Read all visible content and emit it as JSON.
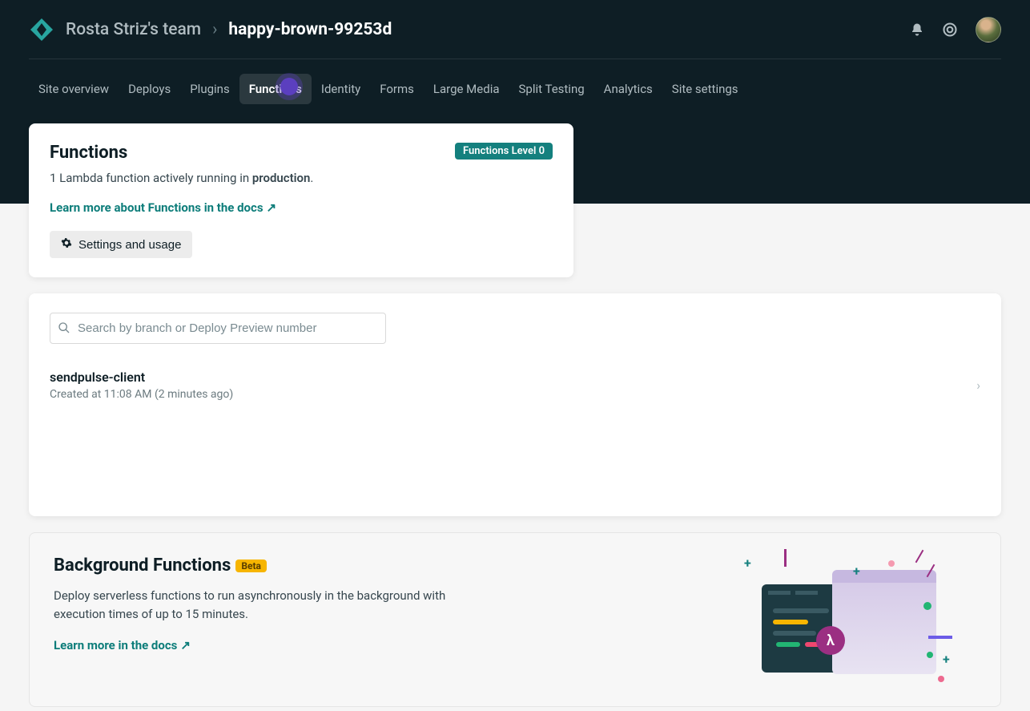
{
  "breadcrumb": {
    "team": "Rosta Striz's team",
    "site": "happy-brown-99253d"
  },
  "tabs": [
    {
      "label": "Site overview",
      "active": false
    },
    {
      "label": "Deploys",
      "active": false
    },
    {
      "label": "Plugins",
      "active": false
    },
    {
      "label": "Functions",
      "active": true
    },
    {
      "label": "Identity",
      "active": false
    },
    {
      "label": "Forms",
      "active": false
    },
    {
      "label": "Large Media",
      "active": false
    },
    {
      "label": "Split Testing",
      "active": false
    },
    {
      "label": "Analytics",
      "active": false
    },
    {
      "label": "Site settings",
      "active": false
    }
  ],
  "functions_card": {
    "title": "Functions",
    "level_badge": "Functions Level 0",
    "summary_prefix": "1 Lambda function actively running in ",
    "summary_strong": "production",
    "summary_suffix": ".",
    "docs_link": "Learn more about Functions in the docs",
    "settings_btn": "Settings and usage"
  },
  "search": {
    "placeholder": "Search by branch or Deploy Preview number"
  },
  "functions_list": [
    {
      "name": "sendpulse-client",
      "meta": "Created at 11:08 AM (2 minutes ago)"
    }
  ],
  "promo": {
    "title": "Background Functions",
    "badge": "Beta",
    "text": "Deploy serverless functions to run asynchronously in the background with execution times of up to 15 minutes.",
    "link": "Learn more in the docs"
  }
}
